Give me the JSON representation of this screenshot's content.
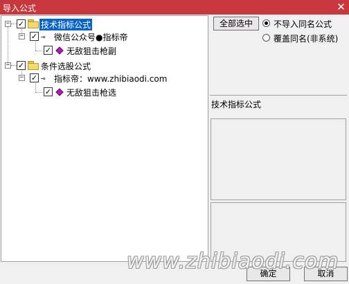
{
  "window": {
    "title": "导入公式",
    "close_glyph": "✕"
  },
  "tree": {
    "checked_glyph": "✓",
    "root1": {
      "label": "技术指标公式",
      "expander": "−"
    },
    "root1_child": {
      "label": "微信公众号●指标帝",
      "expander": "−"
    },
    "root1_leaf": {
      "label": "无敌狙击枪副"
    },
    "root2": {
      "label": "条件选股公式",
      "expander": "−"
    },
    "root2_child": {
      "label": "指标帝：www.zhibiaodi.com",
      "expander": "−"
    },
    "root2_leaf": {
      "label": "无敌狙击枪选"
    }
  },
  "options": {
    "select_all_label": "全部选中",
    "radio_skip_label": "不导入同名公式",
    "radio_overwrite_label": "覆盖同名(非系统)"
  },
  "details": {
    "type_label": "技术指标公式"
  },
  "footer": {
    "ok_label": "确定",
    "cancel_label": "取消"
  },
  "watermark": {
    "text": "www.zhibiaodi.com"
  },
  "colors": {
    "titlebar": "#c8373d",
    "selection": "#0a64c8"
  }
}
